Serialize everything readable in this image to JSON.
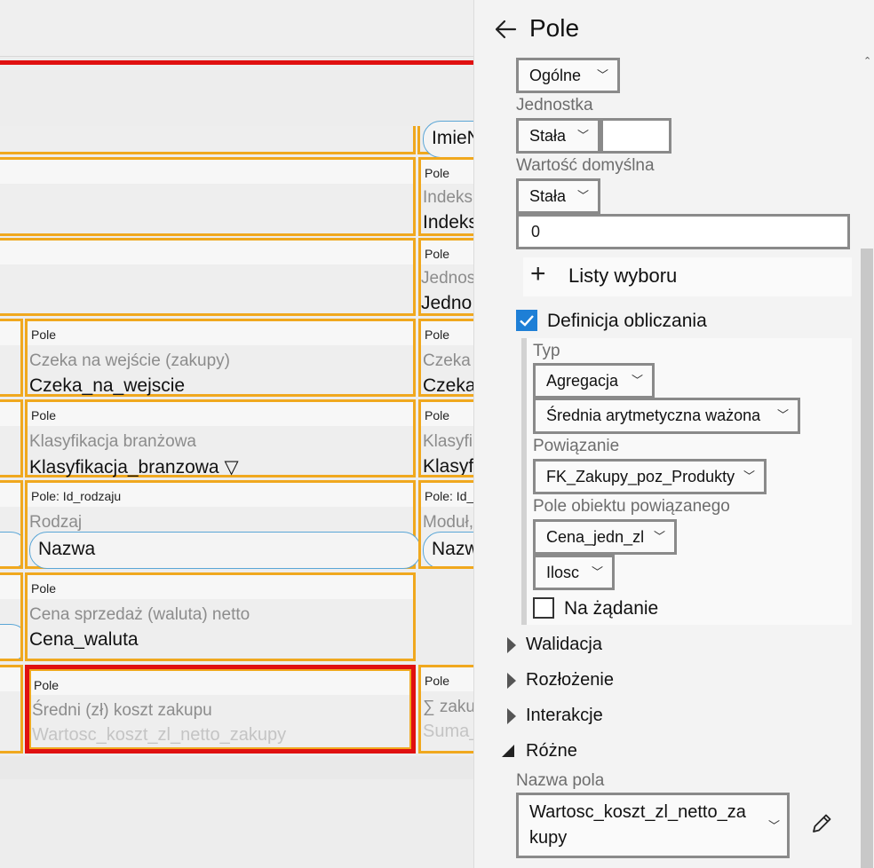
{
  "canvas": {
    "cards": [
      {
        "tag": "Pole",
        "caption": "Indeks",
        "value": "Indeks"
      },
      {
        "tag": "Pole",
        "caption": "Jednos",
        "value": "Jedno"
      },
      {
        "tag": "Pole",
        "caption": "Czeka na wejście (zakupy)",
        "value": "Czeka_na_wejscie"
      },
      {
        "tag": "Pole",
        "caption": "Czeka",
        "value": "Czeka"
      },
      {
        "tag": "Pole",
        "caption": "Klasyfikacja branżowa",
        "value": "Klasyfikacja_branzowa ▽"
      },
      {
        "tag": "Pole",
        "caption": "Klasyfik",
        "value": "Klasyf"
      },
      {
        "tag": "Pole: Id_rodzaju",
        "caption": "Rodzaj",
        "value": "Nazwa"
      },
      {
        "tag": "Pole: Id_",
        "caption": "Moduł,",
        "value": "Nazw"
      },
      {
        "tag": "Pole",
        "caption": "Cena sprzedaż (waluta) netto",
        "value": "Cena_waluta"
      },
      {
        "tag": "Pole",
        "caption": "Średni (zł) koszt zakupu",
        "value": "Wartosc_koszt_zl_netto_zakupy"
      },
      {
        "tag": "Pole",
        "caption": "∑ zaku",
        "value": "Suma_"
      }
    ],
    "top_pill": "ImieN"
  },
  "panel": {
    "back_icon": "arrow-left-icon",
    "title": "Pole",
    "format_value": "Ogólne",
    "unit_label": "Jednostka",
    "unit_mode": "Stała",
    "unit_value": "",
    "default_label": "Wartość domyślna",
    "default_mode": "Stała",
    "default_value": "0",
    "lists_label": "Listy wyboru",
    "calc_def_label": "Definicja obliczania",
    "calc_def_checked": true,
    "type_label": "Typ",
    "type_value": "Agregacja",
    "agg_value": "Średnia arytmetyczna ważona",
    "relation_label": "Powiązanie",
    "relation_value": "FK_Zakupy_poz_Produkty",
    "related_field_label": "Pole obiektu powiązanego",
    "related_field_value": "Cena_jedn_zl",
    "weight_value": "Ilosc",
    "on_demand_label": "Na żądanie",
    "on_demand_checked": false,
    "sections": {
      "validation": "Walidacja",
      "layout": "Rozłożenie",
      "interactions": "Interakcje",
      "misc": "Różne"
    },
    "field_name_label": "Nazwa pola",
    "field_name_value_line1": "Wartosc_koszt_zl_netto_za",
    "field_name_value_line2": "kupy"
  },
  "colors": {
    "selection_border": "#e01010",
    "field_border": "#f0a81e",
    "checkbox_accent": "#1e7fd6",
    "pill_border": "#5aa6d6"
  }
}
